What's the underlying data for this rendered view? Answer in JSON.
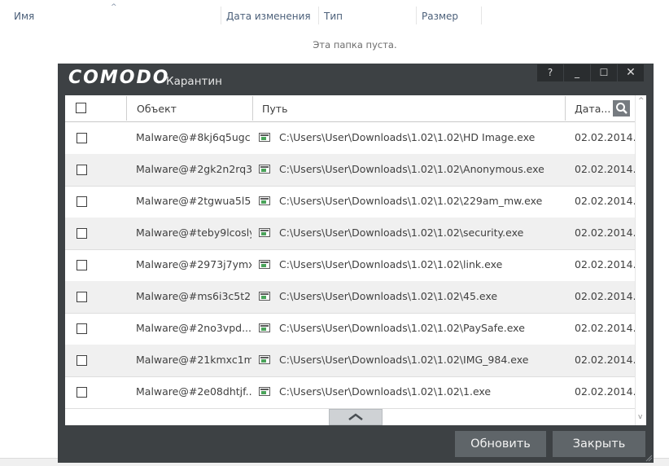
{
  "explorer": {
    "columns": {
      "name": "Имя",
      "date_modified": "Дата изменения",
      "type": "Тип",
      "size": "Размер"
    },
    "empty_message": "Эта папка пуста."
  },
  "dialog": {
    "logo": "COMODO",
    "title": "Карантин",
    "window_buttons": {
      "help": "?",
      "minimize": "_",
      "maximize": "☐",
      "close": "✕"
    },
    "columns": {
      "object": "Объект",
      "path": "Путь",
      "date": "Дата..."
    },
    "rows": [
      {
        "object": "Malware@#8kj6q5ugc...",
        "path": "C:\\Users\\User\\Downloads\\1.02\\1.02\\HD Image.exe",
        "date": "02.02.2014..."
      },
      {
        "object": "Malware@#2gk2n2rq3...",
        "path": "C:\\Users\\User\\Downloads\\1.02\\1.02\\Anonymous.exe",
        "date": "02.02.2014..."
      },
      {
        "object": "Malware@#2tgwua5l5l...",
        "path": "C:\\Users\\User\\Downloads\\1.02\\1.02\\229am_mw.exe",
        "date": "02.02.2014..."
      },
      {
        "object": "Malware@#teby9lcoslyl",
        "path": "C:\\Users\\User\\Downloads\\1.02\\1.02\\security.exe",
        "date": "02.02.2014..."
      },
      {
        "object": "Malware@#2973j7ymx...",
        "path": "C:\\Users\\User\\Downloads\\1.02\\1.02\\link.exe",
        "date": "02.02.2014..."
      },
      {
        "object": "Malware@#ms6i3c5t2...",
        "path": "C:\\Users\\User\\Downloads\\1.02\\1.02\\45.exe",
        "date": "02.02.2014..."
      },
      {
        "object": "Malware@#2no3vpd...",
        "path": "C:\\Users\\User\\Downloads\\1.02\\1.02\\PaySafe.exe",
        "date": "02.02.2014..."
      },
      {
        "object": "Malware@#21kmxc1ml...",
        "path": "C:\\Users\\User\\Downloads\\1.02\\1.02\\IMG_984.exe",
        "date": "02.02.2014..."
      },
      {
        "object": "Malware@#2e08dhtjf...",
        "path": "C:\\Users\\User\\Downloads\\1.02\\1.02\\1.exe",
        "date": "02.02.2014..."
      }
    ],
    "buttons": {
      "refresh": "Обновить",
      "close": "Закрыть"
    },
    "icons": {
      "search": "search-icon",
      "collapse": "chevron-up-icon",
      "file": "executable-file-icon"
    }
  }
}
